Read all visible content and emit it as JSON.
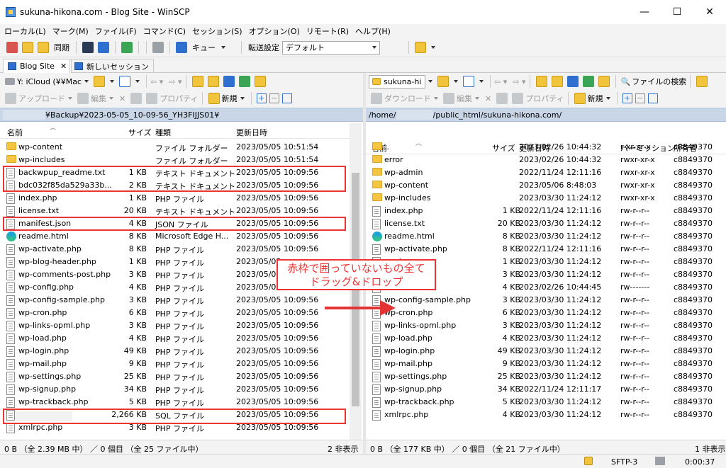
{
  "window": {
    "title": "sukuna-hikona.com - Blog Site - WinSCP",
    "min": "—",
    "max": "☐",
    "close": "✕"
  },
  "menu": [
    "ローカル(L)",
    "マーク(M)",
    "ファイル(F)",
    "コマンド(C)",
    "セッション(S)",
    "オプション(O)",
    "リモート(R)",
    "ヘルプ(H)"
  ],
  "toolbar": {
    "sync_label": "同期",
    "queue_label": "キュー",
    "transfer_label": "転送設定",
    "transfer_value": "デフォルト"
  },
  "tabs": [
    {
      "label": "Blog Site",
      "close": "✕"
    },
    {
      "label": "新しいセッション"
    }
  ],
  "left": {
    "drive": "Y: iCloud (¥¥Mac",
    "actions": {
      "upload": "アップロード",
      "edit": "編集",
      "properties": "プロパティ",
      "new": "新規"
    },
    "path": "¥Backup¥2023-05-05_10-09-56_YH3FIJJS01¥",
    "columns": {
      "name": "名前",
      "size": "サイズ",
      "type": "種類",
      "modified": "更新日時"
    },
    "files": [
      {
        "icon": "folder",
        "name": "wp-content",
        "size": "",
        "type": "ファイル フォルダー",
        "date": "2023/05/05  10:51:54"
      },
      {
        "icon": "folder",
        "name": "wp-includes",
        "size": "",
        "type": "ファイル フォルダー",
        "date": "2023/05/05  10:51:54"
      },
      {
        "icon": "file",
        "name": "backwpup_readme.txt",
        "size": "1 KB",
        "type": "テキスト ドキュメント",
        "date": "2023/05/05  10:09:56"
      },
      {
        "icon": "file",
        "name": "bdc032f85da529a33b...",
        "size": "2 KB",
        "type": "テキスト ドキュメント",
        "date": "2023/05/05  10:09:56"
      },
      {
        "icon": "file",
        "name": "index.php",
        "size": "1 KB",
        "type": "PHP ファイル",
        "date": "2023/05/05  10:09:56"
      },
      {
        "icon": "file",
        "name": "license.txt",
        "size": "20 KB",
        "type": "テキスト ドキュメント",
        "date": "2023/05/05  10:09:56"
      },
      {
        "icon": "file",
        "name": "manifest.json",
        "size": "4 KB",
        "type": "JSON ファイル",
        "date": "2023/05/05  10:09:56"
      },
      {
        "icon": "edge",
        "name": "readme.html",
        "size": "8 KB",
        "type": "Microsoft Edge H...",
        "date": "2023/05/05  10:09:56"
      },
      {
        "icon": "file",
        "name": "wp-activate.php",
        "size": "8 KB",
        "type": "PHP ファイル",
        "date": "2023/05/05  10:09:56"
      },
      {
        "icon": "file",
        "name": "wp-blog-header.php",
        "size": "1 KB",
        "type": "PHP ファイル",
        "date": "2023/05/05"
      },
      {
        "icon": "file",
        "name": "wp-comments-post.php",
        "size": "3 KB",
        "type": "PHP ファイル",
        "date": "2023/05/05"
      },
      {
        "icon": "file",
        "name": "wp-config.php",
        "size": "4 KB",
        "type": "PHP ファイル",
        "date": "2023/05/05"
      },
      {
        "icon": "file",
        "name": "wp-config-sample.php",
        "size": "3 KB",
        "type": "PHP ファイル",
        "date": "2023/05/05  10:09:56"
      },
      {
        "icon": "file",
        "name": "wp-cron.php",
        "size": "6 KB",
        "type": "PHP ファイル",
        "date": "2023/05/05  10:09:56"
      },
      {
        "icon": "file",
        "name": "wp-links-opml.php",
        "size": "3 KB",
        "type": "PHP ファイル",
        "date": "2023/05/05  10:09:56"
      },
      {
        "icon": "file",
        "name": "wp-load.php",
        "size": "4 KB",
        "type": "PHP ファイル",
        "date": "2023/05/05  10:09:56"
      },
      {
        "icon": "file",
        "name": "wp-login.php",
        "size": "49 KB",
        "type": "PHP ファイル",
        "date": "2023/05/05  10:09:56"
      },
      {
        "icon": "file",
        "name": "wp-mail.php",
        "size": "9 KB",
        "type": "PHP ファイル",
        "date": "2023/05/05  10:09:56"
      },
      {
        "icon": "file",
        "name": "wp-settings.php",
        "size": "25 KB",
        "type": "PHP ファイル",
        "date": "2023/05/05  10:09:56"
      },
      {
        "icon": "file",
        "name": "wp-signup.php",
        "size": "34 KB",
        "type": "PHP ファイル",
        "date": "2023/05/05  10:09:56"
      },
      {
        "icon": "file",
        "name": "wp-trackback.php",
        "size": "5 KB",
        "type": "PHP ファイル",
        "date": "2023/05/05  10:09:56"
      },
      {
        "icon": "file",
        "name": ".sql",
        "size": "2,266 KB",
        "type": "SQL ファイル",
        "date": "2023/05/05  10:09:56"
      },
      {
        "icon": "file",
        "name": "xmlrpc.php",
        "size": "3 KB",
        "type": "PHP ファイル",
        "date": "2023/05/05  10:09:56"
      }
    ],
    "status": "0 B （全 2.39 MB 中） ／ 0 個目 （全 25 ファイル中）",
    "hidden": "2 非表示"
  },
  "right": {
    "dir": "sukuna-hi",
    "actions": {
      "download": "ダウンロード",
      "edit": "編集",
      "properties": "プロパティ",
      "new": "新規",
      "find": "ファイルの検索"
    },
    "path_prefix": "/home/",
    "path_suffix": "/public_html/sukuna-hikona.com/",
    "columns": {
      "name": "名前",
      "size": "サイズ",
      "modified": "更新日時",
      "perm": "パーミッション",
      "owner": "所有者"
    },
    "files": [
      {
        "icon": "up",
        "name": "..",
        "size": "",
        "date": "2023/02/26 10:44:32",
        "perm": "r-xr-xr-x",
        "owner": "c8849370"
      },
      {
        "icon": "folder",
        "name": "error",
        "size": "",
        "date": "2023/02/26 10:44:32",
        "perm": "rwxr-xr-x",
        "owner": "c8849370"
      },
      {
        "icon": "folder",
        "name": "wp-admin",
        "size": "",
        "date": "2022/11/24 12:11:16",
        "perm": "rwxr-xr-x",
        "owner": "c8849370"
      },
      {
        "icon": "folder",
        "name": "wp-content",
        "size": "",
        "date": "2023/05/06 8:48:03",
        "perm": "rwxr-xr-x",
        "owner": "c8849370"
      },
      {
        "icon": "folder",
        "name": "wp-includes",
        "size": "",
        "date": "2023/03/30 11:24:12",
        "perm": "rwxr-xr-x",
        "owner": "c8849370"
      },
      {
        "icon": "file",
        "name": "index.php",
        "size": "1 KB",
        "date": "2022/11/24 12:11:16",
        "perm": "rw-r--r--",
        "owner": "c8849370"
      },
      {
        "icon": "file",
        "name": "license.txt",
        "size": "20 KB",
        "date": "2023/03/30 11:24:12",
        "perm": "rw-r--r--",
        "owner": "c8849370"
      },
      {
        "icon": "edge",
        "name": "readme.html",
        "size": "8 KB",
        "date": "2023/03/30 11:24:12",
        "perm": "rw-r--r--",
        "owner": "c8849370"
      },
      {
        "icon": "file",
        "name": "wp-activate.php",
        "size": "8 KB",
        "date": "2022/11/24 12:11:16",
        "perm": "rw-r--r--",
        "owner": "c8849370"
      },
      {
        "icon": "file",
        "name": "er.php",
        "size": "1 KB",
        "date": "2023/03/30 11:24:12",
        "perm": "rw-r--r--",
        "owner": "c8849370"
      },
      {
        "icon": "file",
        "name": "ost.p...",
        "size": "3 KB",
        "date": "2023/03/30 11:24:12",
        "perm": "rw-r--r--",
        "owner": "c8849370"
      },
      {
        "icon": "file",
        "name": "",
        "size": "4 KB",
        "date": "2023/02/26 10:44:45",
        "perm": "rw-------",
        "owner": "c8849370"
      },
      {
        "icon": "file",
        "name": "wp-config-sample.php",
        "size": "3 KB",
        "date": "2023/03/30 11:24:12",
        "perm": "rw-r--r--",
        "owner": "c8849370"
      },
      {
        "icon": "file",
        "name": "wp-cron.php",
        "size": "6 KB",
        "date": "2023/03/30 11:24:12",
        "perm": "rw-r--r--",
        "owner": "c8849370"
      },
      {
        "icon": "file",
        "name": "wp-links-opml.php",
        "size": "3 KB",
        "date": "2023/03/30 11:24:12",
        "perm": "rw-r--r--",
        "owner": "c8849370"
      },
      {
        "icon": "file",
        "name": "wp-load.php",
        "size": "4 KB",
        "date": "2023/03/30 11:24:12",
        "perm": "rw-r--r--",
        "owner": "c8849370"
      },
      {
        "icon": "file",
        "name": "wp-login.php",
        "size": "49 KB",
        "date": "2023/03/30 11:24:12",
        "perm": "rw-r--r--",
        "owner": "c8849370"
      },
      {
        "icon": "file",
        "name": "wp-mail.php",
        "size": "9 KB",
        "date": "2023/03/30 11:24:12",
        "perm": "rw-r--r--",
        "owner": "c8849370"
      },
      {
        "icon": "file",
        "name": "wp-settings.php",
        "size": "25 KB",
        "date": "2023/03/30 11:24:12",
        "perm": "rw-r--r--",
        "owner": "c8849370"
      },
      {
        "icon": "file",
        "name": "wp-signup.php",
        "size": "34 KB",
        "date": "2022/11/24 12:11:17",
        "perm": "rw-r--r--",
        "owner": "c8849370"
      },
      {
        "icon": "file",
        "name": "wp-trackback.php",
        "size": "5 KB",
        "date": "2023/03/30 11:24:12",
        "perm": "rw-r--r--",
        "owner": "c8849370"
      },
      {
        "icon": "file",
        "name": "xmlrpc.php",
        "size": "4 KB",
        "date": "2023/03/30 11:24:12",
        "perm": "rw-r--r--",
        "owner": "c8849370"
      }
    ],
    "status": "0 B （全 177 KB 中） ／ 0 個目 （全 21 ファイル中）",
    "hidden": "1 非表示"
  },
  "bottom": {
    "protocol": "SFTP-3",
    "time": "0:00:37"
  },
  "annotation": {
    "line1": "赤枠で囲っていないもの全て",
    "line2": "ドラッグ&ドロップ",
    "color": "#e33333"
  }
}
